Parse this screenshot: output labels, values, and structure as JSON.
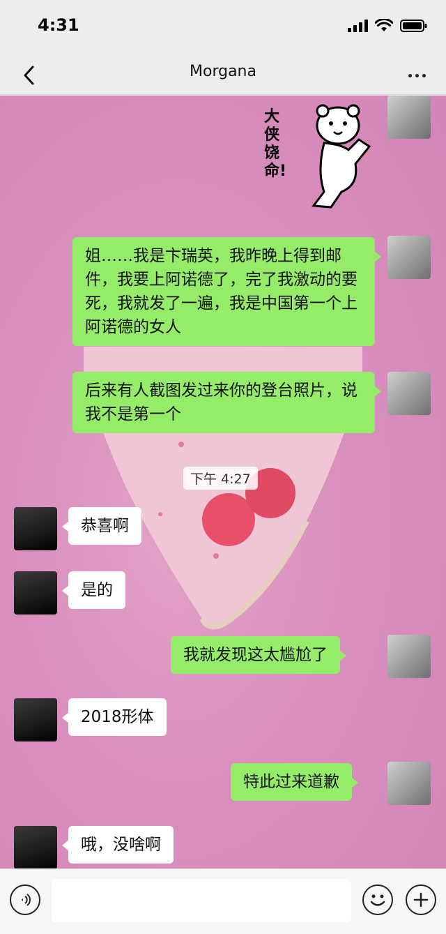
{
  "status_bar": {
    "time": "4:31"
  },
  "header": {
    "title": "Morgana"
  },
  "sticker": {
    "text": "大侠饶命!"
  },
  "timestamp": "下午 4:27",
  "messages": [
    {
      "sender": "me",
      "text": "姐……我是卞瑞英，我昨晚上得到邮件，我要上阿诺德了，完了我激动的要死，我就发了一遍，我是中国第一个上阿诺德的女人"
    },
    {
      "sender": "me",
      "text": "后来有人截图发过来你的登台照片，说我不是第一个"
    },
    {
      "sender": "other",
      "text": "恭喜啊"
    },
    {
      "sender": "other",
      "text": "是的"
    },
    {
      "sender": "me",
      "text": "我就发现这太尴尬了"
    },
    {
      "sender": "other",
      "text": "2018形体"
    },
    {
      "sender": "me",
      "text": "特此过来道歉"
    },
    {
      "sender": "other",
      "text": "哦，没啥啊"
    }
  ],
  "input": {
    "placeholder": ""
  },
  "colors": {
    "bubble_me": "#95ec69",
    "bubble_other": "#ffffff",
    "background": "#d98fbd"
  }
}
